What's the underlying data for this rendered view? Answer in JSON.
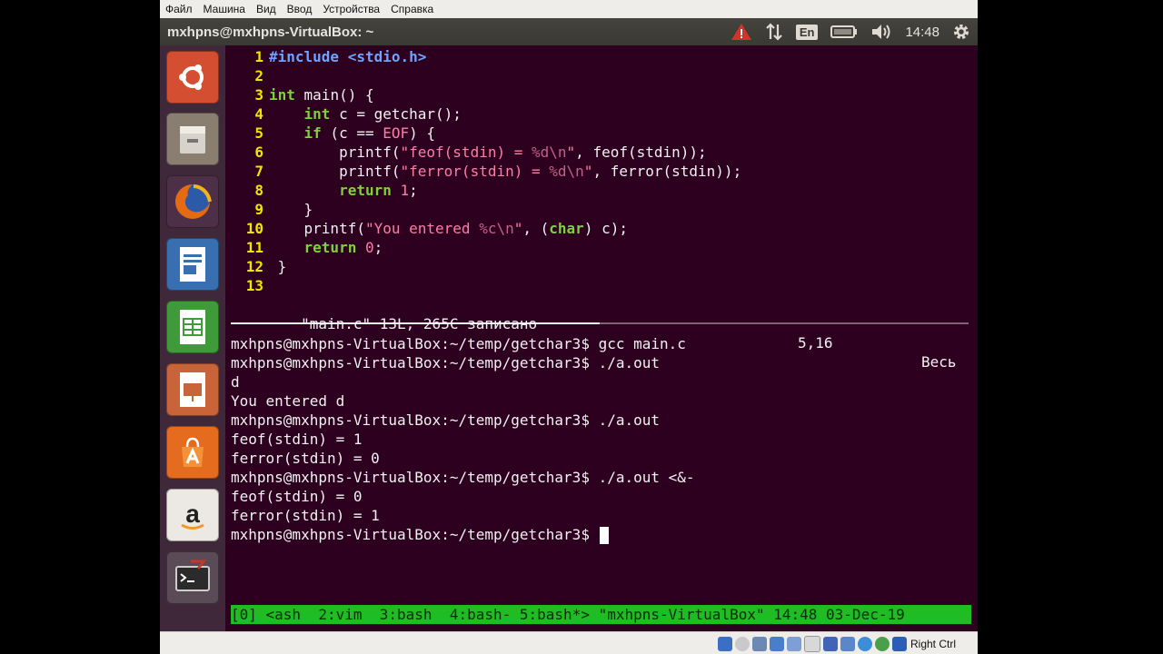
{
  "vbox_menu": [
    "Файл",
    "Машина",
    "Вид",
    "Ввод",
    "Устройства",
    "Справка"
  ],
  "window_title": "mxhpns@mxhpns-VirtualBox: ~",
  "indicators": {
    "lang": "En",
    "time": "14:48"
  },
  "launcher": [
    "dash-home-icon",
    "files-icon",
    "firefox-icon",
    "writer-icon",
    "calc-icon",
    "impress-icon",
    "software-center-icon",
    "amazon-icon",
    "terminal-icon"
  ],
  "code_lines": [
    {
      "n": "1"
    },
    {
      "n": "2"
    },
    {
      "n": "3"
    },
    {
      "n": "4"
    },
    {
      "n": "5"
    },
    {
      "n": "6"
    },
    {
      "n": "7"
    },
    {
      "n": "8"
    },
    {
      "n": "9"
    },
    {
      "n": "10"
    },
    {
      "n": "11"
    },
    {
      "n": "12"
    },
    {
      "n": "13"
    }
  ],
  "code_tokens": {
    "l1": [
      "#include <stdio.h>"
    ],
    "l3": [
      "int",
      " main() {"
    ],
    "l4": [
      "    ",
      "int",
      " c = getchar();"
    ],
    "l5": [
      "    ",
      "if",
      " (c == ",
      "EOF",
      ") {"
    ],
    "l6": [
      "        printf(",
      "\"feof(stdin) = ",
      "%d\\n",
      "\"",
      ", feof(stdin));"
    ],
    "l7": [
      "        printf(",
      "\"ferror(stdin) = ",
      "%d\\n",
      "\"",
      ", ferror(stdin));"
    ],
    "l8": [
      "        ",
      "return",
      " ",
      "1",
      ";"
    ],
    "l9": [
      "    }"
    ],
    "l10": [
      "    printf(",
      "\"You entered ",
      "%c\\n",
      "\"",
      ", (",
      "char",
      ") c);"
    ],
    "l11": [
      "    ",
      "return",
      " ",
      "0",
      ";"
    ],
    "l12": [
      " }"
    ]
  },
  "vim_status": {
    "file": "\"main.c\" 13L, 265C записано",
    "pos": "5,16",
    "scroll": "Весь"
  },
  "terminal_lines": [
    "mxhpns@mxhpns-VirtualBox:~/temp/getchar3$ gcc main.c",
    "mxhpns@mxhpns-VirtualBox:~/temp/getchar3$ ./a.out",
    "d",
    "You entered d",
    "mxhpns@mxhpns-VirtualBox:~/temp/getchar3$ ./a.out",
    "feof(stdin) = 1",
    "ferror(stdin) = 0",
    "mxhpns@mxhpns-VirtualBox:~/temp/getchar3$ ./a.out <&-",
    "feof(stdin) = 0",
    "ferror(stdin) = 1",
    "mxhpns@mxhpns-VirtualBox:~/temp/getchar3$ "
  ],
  "tmux_status": "[0] <ash  2:vim  3:bash  4:bash- 5:bash*> \"mxhpns-VirtualBox\" 14:48 03-Dec-19",
  "vbox_status": {
    "host_key": "Right Ctrl"
  },
  "colors": {
    "terminal_bg": "#2c001e",
    "line_number": "#f2e600",
    "keyword": "#7fd13a",
    "string": "#ff7ea6",
    "tmux_bar": "#1fbc23"
  }
}
